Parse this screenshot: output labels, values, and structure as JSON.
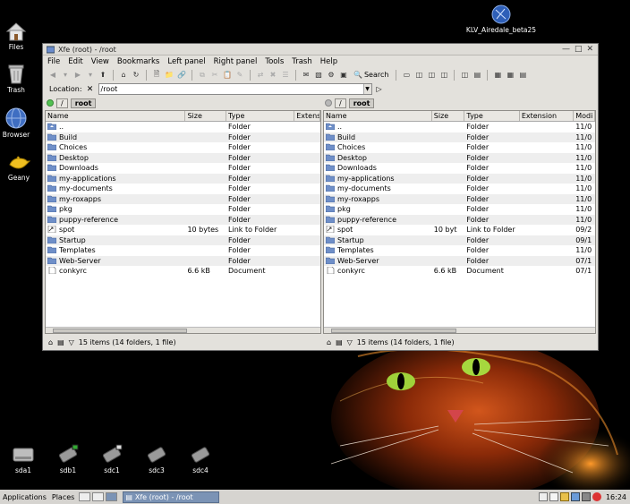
{
  "desktop": {
    "icons": [
      {
        "label": "Files",
        "icon": "home-icon"
      },
      {
        "label": "Trash",
        "icon": "trash-icon"
      },
      {
        "label": "Browser",
        "icon": "globe-icon"
      },
      {
        "label": "Geany",
        "icon": "genie-lamp-icon"
      }
    ],
    "top_right_label": "KLV_Airedale_beta25",
    "drives": [
      "sda1",
      "sdb1",
      "sdc1",
      "sdc3",
      "sdc4"
    ]
  },
  "window": {
    "title": "Xfe (root) - /root",
    "menus": [
      "File",
      "Edit",
      "View",
      "Bookmarks",
      "Left panel",
      "Right panel",
      "Tools",
      "Trash",
      "Help"
    ],
    "search_label": "Search",
    "location_label": "Location:",
    "location_value": "/root"
  },
  "left_panel": {
    "path_root": "/",
    "path_current": "root",
    "columns": [
      "Name",
      "Size",
      "Type",
      "Extensi"
    ],
    "rows": [
      {
        "name": "..",
        "size": "",
        "type": "Folder",
        "ext": "",
        "icon": "up"
      },
      {
        "name": "Build",
        "size": "",
        "type": "Folder",
        "ext": "",
        "icon": "folder"
      },
      {
        "name": "Choices",
        "size": "",
        "type": "Folder",
        "ext": "",
        "icon": "folder"
      },
      {
        "name": "Desktop",
        "size": "",
        "type": "Folder",
        "ext": "",
        "icon": "folder"
      },
      {
        "name": "Downloads",
        "size": "",
        "type": "Folder",
        "ext": "",
        "icon": "folder"
      },
      {
        "name": "my-applications",
        "size": "",
        "type": "Folder",
        "ext": "",
        "icon": "folder"
      },
      {
        "name": "my-documents",
        "size": "",
        "type": "Folder",
        "ext": "",
        "icon": "folder"
      },
      {
        "name": "my-roxapps",
        "size": "",
        "type": "Folder",
        "ext": "",
        "icon": "folder"
      },
      {
        "name": "pkg",
        "size": "",
        "type": "Folder",
        "ext": "",
        "icon": "folder"
      },
      {
        "name": "puppy-reference",
        "size": "",
        "type": "Folder",
        "ext": "",
        "icon": "folder"
      },
      {
        "name": "spot",
        "size": "10 bytes",
        "type": "Link to Folder",
        "ext": "",
        "icon": "link"
      },
      {
        "name": "Startup",
        "size": "",
        "type": "Folder",
        "ext": "",
        "icon": "folder"
      },
      {
        "name": "Templates",
        "size": "",
        "type": "Folder",
        "ext": "",
        "icon": "folder"
      },
      {
        "name": "Web-Server",
        "size": "",
        "type": "Folder",
        "ext": "",
        "icon": "folder"
      },
      {
        "name": "conkyrc",
        "size": "6.6 kB",
        "type": "Document",
        "ext": "",
        "icon": "doc"
      }
    ],
    "status": "15 items (14 folders, 1 file)"
  },
  "right_panel": {
    "path_root": "/",
    "path_current": "root",
    "columns": [
      "Name",
      "Size",
      "Type",
      "Extension",
      "Modi"
    ],
    "rows": [
      {
        "name": "..",
        "size": "",
        "type": "Folder",
        "ext": "",
        "mod": "11/0",
        "icon": "up"
      },
      {
        "name": "Build",
        "size": "",
        "type": "Folder",
        "ext": "",
        "mod": "11/0",
        "icon": "folder"
      },
      {
        "name": "Choices",
        "size": "",
        "type": "Folder",
        "ext": "",
        "mod": "11/0",
        "icon": "folder"
      },
      {
        "name": "Desktop",
        "size": "",
        "type": "Folder",
        "ext": "",
        "mod": "11/0",
        "icon": "folder"
      },
      {
        "name": "Downloads",
        "size": "",
        "type": "Folder",
        "ext": "",
        "mod": "11/0",
        "icon": "folder"
      },
      {
        "name": "my-applications",
        "size": "",
        "type": "Folder",
        "ext": "",
        "mod": "11/0",
        "icon": "folder"
      },
      {
        "name": "my-documents",
        "size": "",
        "type": "Folder",
        "ext": "",
        "mod": "11/0",
        "icon": "folder"
      },
      {
        "name": "my-roxapps",
        "size": "",
        "type": "Folder",
        "ext": "",
        "mod": "11/0",
        "icon": "folder"
      },
      {
        "name": "pkg",
        "size": "",
        "type": "Folder",
        "ext": "",
        "mod": "11/0",
        "icon": "folder"
      },
      {
        "name": "puppy-reference",
        "size": "",
        "type": "Folder",
        "ext": "",
        "mod": "11/0",
        "icon": "folder"
      },
      {
        "name": "spot",
        "size": "10 byt",
        "type": "Link to Folder",
        "ext": "",
        "mod": "09/2",
        "icon": "link"
      },
      {
        "name": "Startup",
        "size": "",
        "type": "Folder",
        "ext": "",
        "mod": "09/1",
        "icon": "folder"
      },
      {
        "name": "Templates",
        "size": "",
        "type": "Folder",
        "ext": "",
        "mod": "11/0",
        "icon": "folder"
      },
      {
        "name": "Web-Server",
        "size": "",
        "type": "Folder",
        "ext": "",
        "mod": "07/1",
        "icon": "folder"
      },
      {
        "name": "conkyrc",
        "size": "6.6 kB",
        "type": "Document",
        "ext": "",
        "mod": "07/1",
        "icon": "doc"
      }
    ],
    "status": "15 items (14 folders, 1 file)"
  },
  "taskbar": {
    "applications": "Applications",
    "places": "Places",
    "task_title": "Xfe (root) - /root",
    "clock": "16:24"
  }
}
